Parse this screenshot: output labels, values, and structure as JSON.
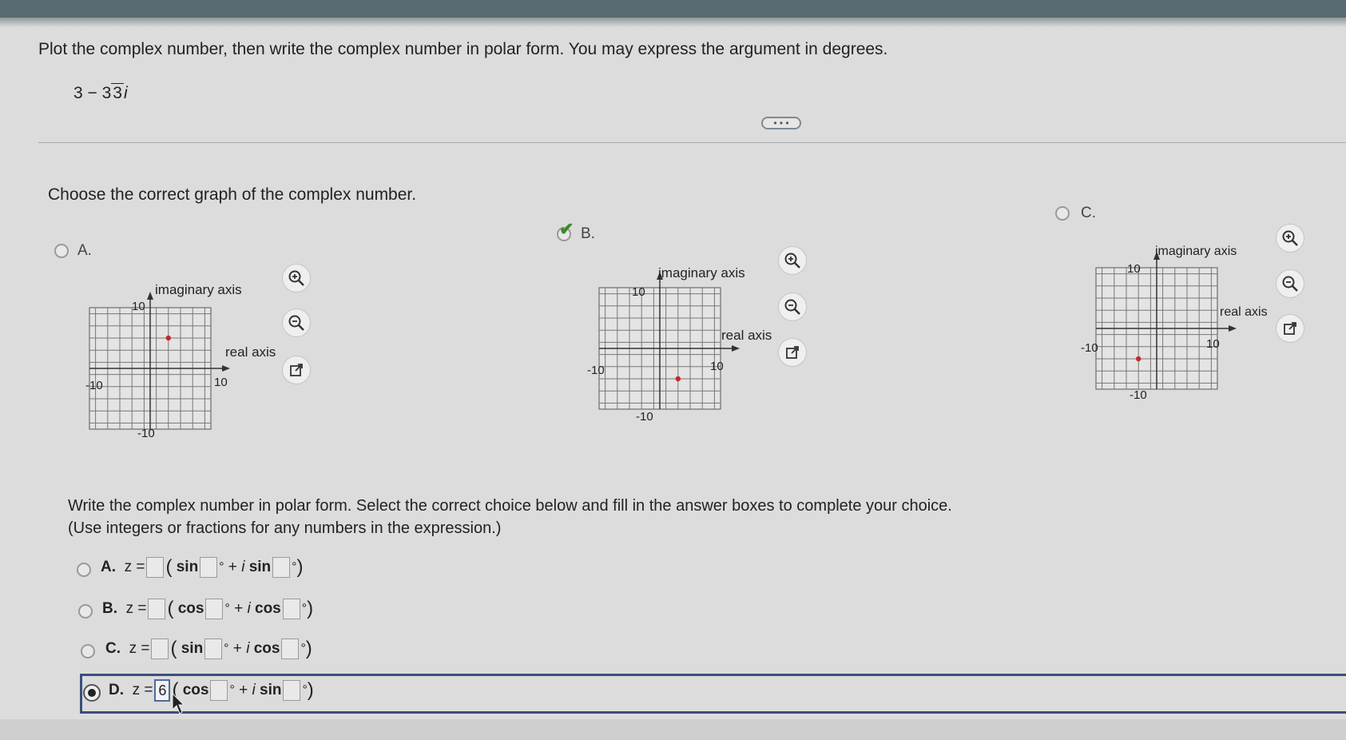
{
  "instruction": "Plot the complex number, then write the complex number in polar form. You may express the argument in degrees.",
  "problem": {
    "prefix": "3 − 3",
    "radicand": "3",
    "suffix": "i"
  },
  "more_button": "• • •",
  "graph_question": "Choose the correct graph of the complex number.",
  "graph_options": [
    {
      "letter": "A.",
      "imag_label": "imaginary axis",
      "real_label": "real axis",
      "top": "10",
      "left": "-10",
      "right": "10",
      "bottom": "-10",
      "point": [
        3,
        5
      ]
    },
    {
      "letter": "B.",
      "imag_label": "imaginary axis",
      "real_label": "real axis",
      "top": "10",
      "left": "-10",
      "right": "10",
      "bottom": "-10",
      "point": [
        3,
        -5
      ]
    },
    {
      "letter": "C.",
      "imag_label": "imaginary axis",
      "real_label": "real axis",
      "top": "10",
      "left": "-10",
      "right": "10",
      "bottom": "-10",
      "point": [
        -3,
        -5
      ]
    }
  ],
  "polar_question": "Write the complex number in polar form. Select the correct choice below and fill in the answer boxes to complete your choice.",
  "polar_hint": "(Use integers or fractions for any numbers in the expression.)",
  "polar_options": [
    {
      "letter": "A.",
      "z": "z =",
      "f1": "sin",
      "f2": "sin",
      "i": "i",
      "plus": "+",
      "deg": "°"
    },
    {
      "letter": "B.",
      "z": "z =",
      "f1": "cos",
      "f2": "cos",
      "i": "i",
      "plus": "+",
      "deg": "°"
    },
    {
      "letter": "C.",
      "z": "z =",
      "f1": "sin",
      "f2": "cos",
      "i": "i",
      "plus": "+",
      "deg": "°"
    },
    {
      "letter": "D.",
      "z": "z =",
      "f1": "cos",
      "f2": "sin",
      "i": "i",
      "plus": "+",
      "deg": "°",
      "modulus": "6"
    }
  ],
  "colors": {
    "point": "#c42a2a",
    "selected_border": "#3b4f7a",
    "correct_check": "#3a8a2a"
  },
  "icons": [
    "zoom-in-icon",
    "zoom-out-icon",
    "popout-icon",
    "checkmark-icon"
  ]
}
